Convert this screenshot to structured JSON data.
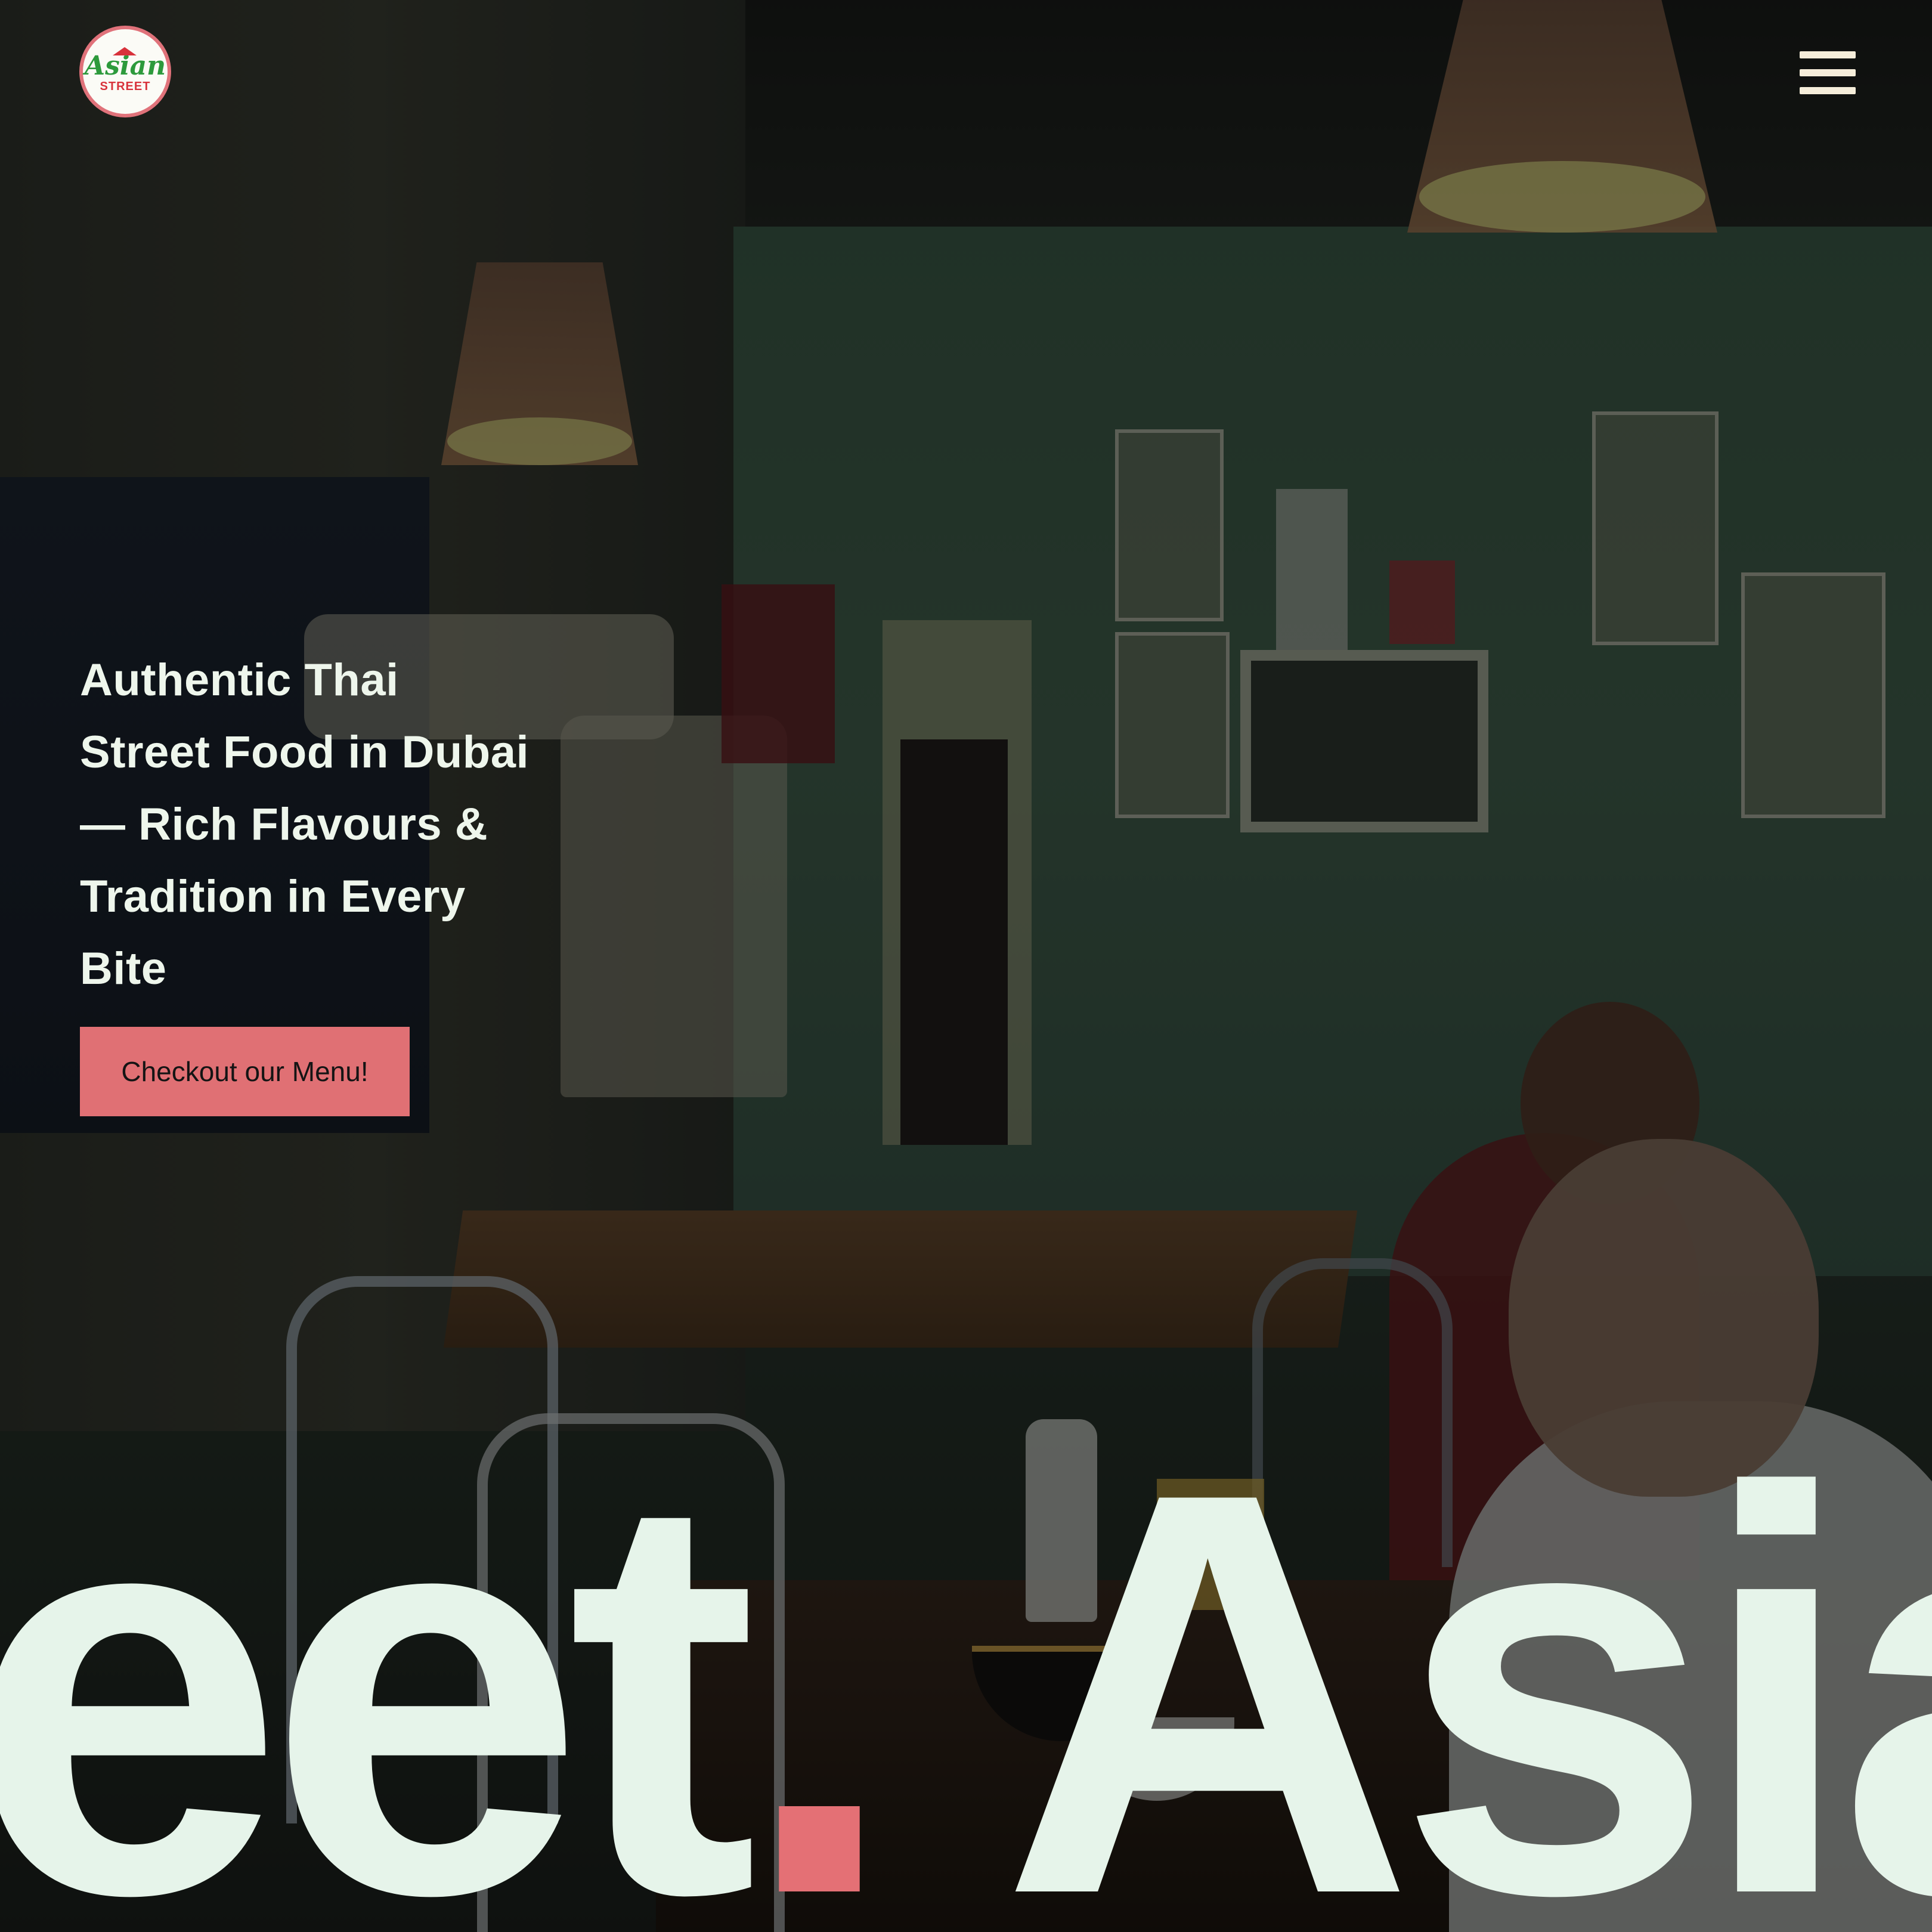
{
  "brand": {
    "logo_top_text": "Asian",
    "logo_bottom_text": "STREET",
    "colors": {
      "accent": "#e07074",
      "headline_text": "#eef6ec",
      "marquee_text": "#e6f4ea",
      "menu_icon": "#f5edda"
    }
  },
  "header": {
    "menu_icon": "hamburger-menu-icon"
  },
  "hero": {
    "headline_lines": [
      "Authentic Thai",
      "Street Food in Dubai",
      "— Rich Flavours &",
      "Tradition in Every",
      "Bite"
    ],
    "cta_label": "Checkout our Menu!"
  },
  "marquee": {
    "text_before": "reet",
    "dot": ".",
    "text_after": " Asia"
  }
}
